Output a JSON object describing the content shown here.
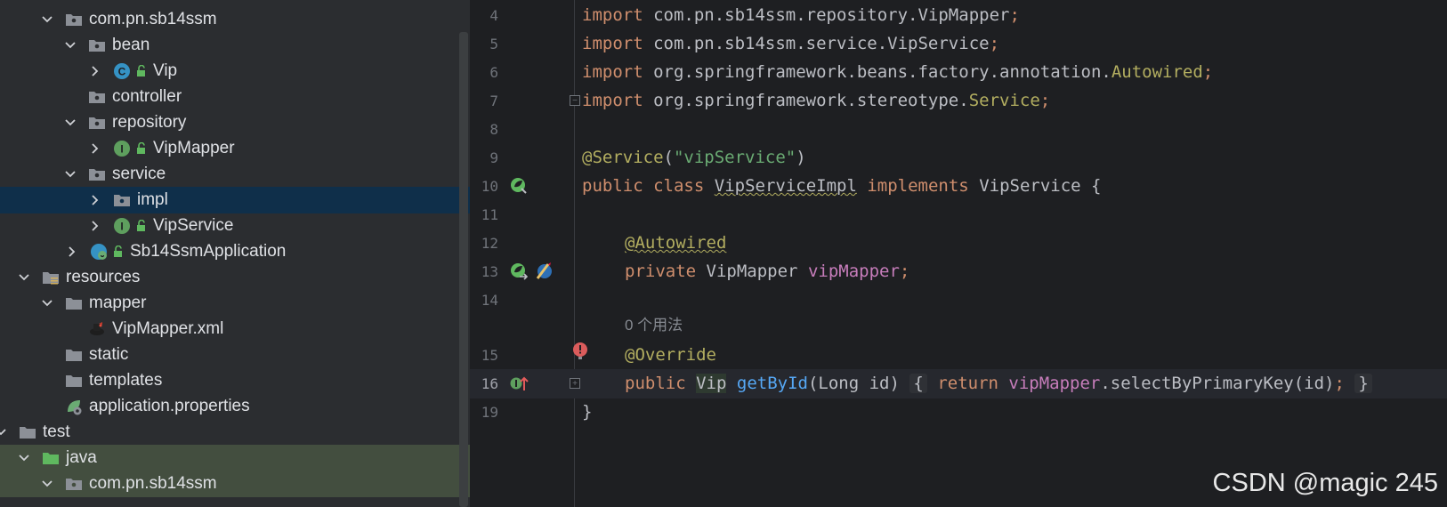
{
  "project_tree": {
    "items": [
      {
        "label": "com.pn.sb14ssm"
      },
      {
        "label": "bean"
      },
      {
        "label": "Vip",
        "type_letter": "C"
      },
      {
        "label": "controller"
      },
      {
        "label": "repository"
      },
      {
        "label": "VipMapper",
        "type_letter": "I"
      },
      {
        "label": "service"
      },
      {
        "label": "impl"
      },
      {
        "label": "VipService",
        "type_letter": "I"
      },
      {
        "label": "Sb14SsmApplication"
      },
      {
        "label": "resources"
      },
      {
        "label": "mapper"
      },
      {
        "label": "VipMapper.xml"
      },
      {
        "label": "static"
      },
      {
        "label": "templates"
      },
      {
        "label": "application.properties"
      },
      {
        "label": "test"
      },
      {
        "label": "java"
      },
      {
        "label": "com.pn.sb14ssm"
      }
    ]
  },
  "editor": {
    "line_numbers": [
      "4",
      "5",
      "6",
      "7",
      "8",
      "9",
      "10",
      "11",
      "12",
      "13",
      "14",
      "15",
      "16",
      "19"
    ],
    "lines": {
      "l4": {
        "kw": "import",
        "rest": " com.pn.sb14ssm.repository.VipMapper",
        "semi": ";"
      },
      "l5": {
        "kw": "import",
        "rest": " com.pn.sb14ssm.service.VipService",
        "semi": ";"
      },
      "l6": {
        "kw": "import",
        "rest": " org.springframework.beans.factory.annotation.",
        "cls": "Autowired",
        "semi": ";"
      },
      "l7": {
        "kw": "import",
        "rest": " org.springframework.stereotype.",
        "cls": "Service",
        "semi": ";"
      },
      "l9": {
        "ann": "@Service",
        "open": "(",
        "str": "\"vipService\"",
        "close": ")"
      },
      "l10": {
        "kw1": "public",
        "kw2": "class",
        "cls": "VipServiceImpl",
        "kw3": "implements",
        "iface": "VipService",
        "brace": "{"
      },
      "l12": {
        "ann": "@Autowired"
      },
      "l13": {
        "kw": "private",
        "type": "VipMapper",
        "field": "vipMapper",
        "semi": ";"
      },
      "hint": "0 个用法",
      "l15": {
        "ann": "@Override"
      },
      "l16": {
        "kw": "public",
        "type": "Vip",
        "fn": "getById",
        "params_open": "(",
        "ptype": "Long",
        "pname": " id",
        "params_close": ")",
        "lbrace": "{",
        "ret": "return",
        "field": "vipMapper",
        "call": ".selectByPrimaryKey(id)",
        "semi": ";",
        "rbrace": "}"
      },
      "l19": {
        "brace": "}"
      }
    }
  },
  "watermark": "CSDN @magic 245",
  "colors": {
    "keyword": "#cf8e6d",
    "annotation": "#b3ae60",
    "string": "#6aab73",
    "field": "#c77dbb",
    "function": "#56a8f5"
  }
}
